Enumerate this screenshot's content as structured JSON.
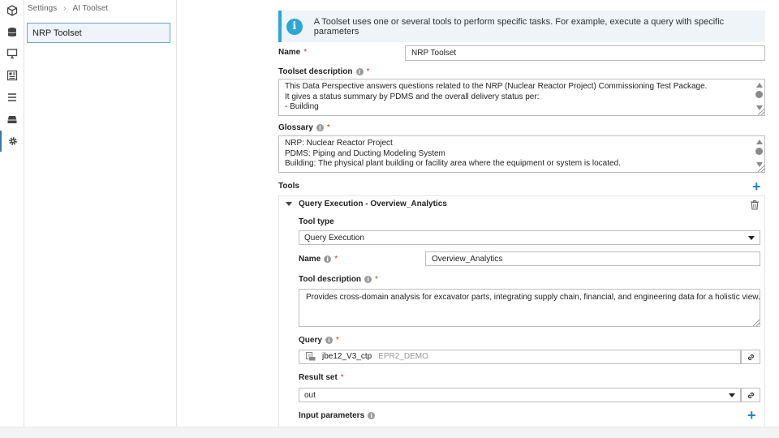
{
  "breadcrumb": {
    "root": "Settings",
    "current": "AI Toolset"
  },
  "nav": {
    "selected_item": "NRP Toolset"
  },
  "rail": [
    "cube-icon",
    "database-icon",
    "monitor-icon",
    "dashboard-icon",
    "list-icon",
    "tray-icon",
    "gear-icon"
  ],
  "info": {
    "text": "A Toolset uses one or several tools to perform specific tasks. For example, execute a query with specific parameters"
  },
  "form": {
    "name_label": "Name",
    "name_value": "NRP Toolset",
    "desc_label": "Toolset description",
    "desc_lines": [
      "This Data Perspective answers questions related to the NRP (Nuclear Reactor Project) Commissioning Test Package.",
      "It gives a status summary by PDMS and the overall delivery status per:",
      "- Building"
    ],
    "glossary_label": "Glossary",
    "glossary_lines": [
      "NRP: Nuclear Reactor Project",
      "PDMS: Piping and Ducting Modeling System",
      "Building: The physical plant building or facility area where the equipment or system is located."
    ],
    "tools_label": "Tools",
    "required_mark": "*"
  },
  "tool": {
    "header": "Query Execution - Overview_Analytics",
    "type_label": "Tool type",
    "type_value": "Query Execution",
    "name_label": "Name",
    "name_value": "Overview_Analytics",
    "desc_label": "Tool description",
    "desc_value": "Provides cross-domain analysis for excavator parts, integrating supply chain, financial, and engineering data for a holistic view.",
    "query_label": "Query",
    "query_name": "jbe12_V3_ctp",
    "query_db": "EPR2_DEMO",
    "resultset_label": "Result set",
    "resultset_value": "out",
    "input_params_label": "Input parameters"
  },
  "colors": {
    "accent": "#2b7fc1",
    "info_bar": "#2ba7d6",
    "required": "#c0392b",
    "selected_border": "#6aa3cc"
  }
}
